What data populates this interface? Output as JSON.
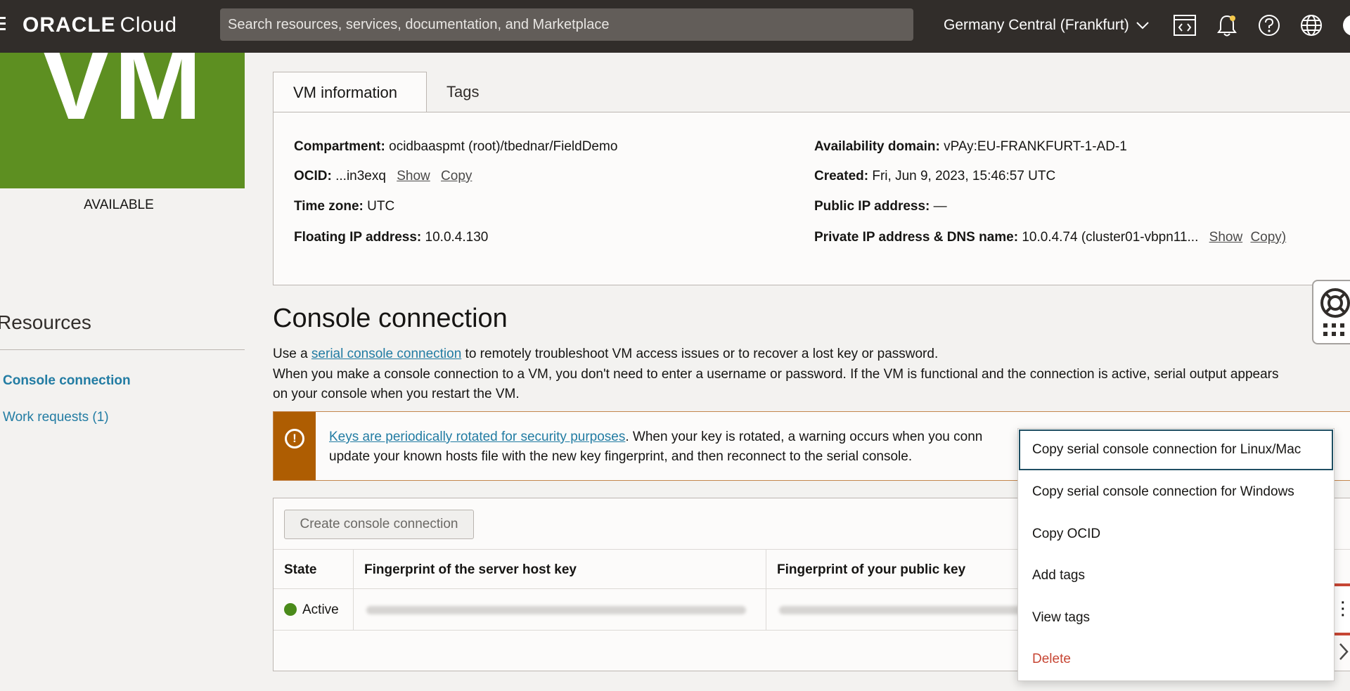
{
  "header": {
    "brand": "ORACLE",
    "brand_suffix": "Cloud",
    "search_placeholder": "Search resources, services, documentation, and Marketplace",
    "region": "Germany Central (Frankfurt)"
  },
  "vm_tile": {
    "label": "VM",
    "status": "AVAILABLE",
    "color": "#5d8f21"
  },
  "resources": {
    "title": "Resources",
    "items": [
      {
        "label": "Console connection",
        "active": true
      },
      {
        "label": "Work requests (1)",
        "active": false
      }
    ]
  },
  "tabs": [
    {
      "label": "VM information",
      "selected": true
    },
    {
      "label": "Tags",
      "selected": false
    }
  ],
  "vm_info": {
    "compartment_label": "Compartment:",
    "compartment_value": "ocidbaaspmt (root)/tbednar/FieldDemo",
    "ocid_label": "OCID:",
    "ocid_value": "...in3exq",
    "show_label": "Show",
    "copy_label": "Copy",
    "timezone_label": "Time zone:",
    "timezone_value": "UTC",
    "floating_ip_label": "Floating IP address:",
    "floating_ip_value": "10.0.4.130",
    "ad_label": "Availability domain:",
    "ad_value": "vPAy:EU-FRANKFURT-1-AD-1",
    "created_label": "Created:",
    "created_value": "Fri, Jun 9, 2023, 15:46:57 UTC",
    "public_ip_label": "Public IP address:",
    "public_ip_value": "—",
    "private_ip_label": "Private IP address & DNS name:",
    "private_ip_value": "10.0.4.74 (cluster01-vbpn11...",
    "private_show": "Show",
    "private_copy": "Copy)"
  },
  "console": {
    "title": "Console connection",
    "line1_pre": "Use a ",
    "line1_link": "serial console connection",
    "line1_post": " to remotely troubleshoot VM access issues or to recover a lost key or password.",
    "line2": "When you make a console connection to a VM, you don't need to enter a username or password. If the VM is functional and the connection is active, serial output appears",
    "line3": "on your console when you restart the VM.",
    "banner_link": "Keys are periodically rotated for security purposes",
    "banner_rest": ". When your key is rotated, a warning occurs when you conn",
    "banner_line2": "update your known hosts file with the new key fingerprint, and then reconnect to the serial console.",
    "create_button": "Create console connection",
    "columns": [
      "State",
      "Fingerprint of the server host key",
      "Fingerprint of your public key"
    ],
    "row_state": "Active"
  },
  "context_menu": {
    "items": [
      "Copy serial console connection for Linux/Mac",
      "Copy serial console connection for Windows",
      "Copy OCID",
      "Add tags",
      "View tags",
      "Delete"
    ]
  },
  "colors": {
    "header_bg": "#312d2a",
    "link": "#227ca3",
    "warning": "#ae5d02",
    "danger": "#c74634",
    "active_status": "#4a8a1a"
  }
}
